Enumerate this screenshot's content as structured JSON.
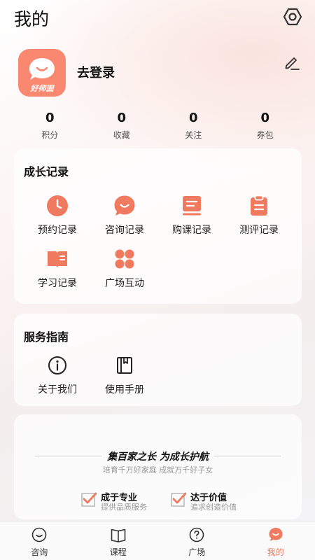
{
  "header": {
    "title": "我的"
  },
  "profile": {
    "login_text": "去登录",
    "avatar_brand": "好师固"
  },
  "stats": [
    {
      "value": "0",
      "label": "积分"
    },
    {
      "value": "0",
      "label": "收藏"
    },
    {
      "value": "0",
      "label": "关注"
    },
    {
      "value": "0",
      "label": "券包"
    }
  ],
  "growth": {
    "title": "成长记录",
    "items": [
      {
        "label": "预约记录",
        "icon": "clock-icon"
      },
      {
        "label": "咨询记录",
        "icon": "chat-bubble-icon"
      },
      {
        "label": "购课记录",
        "icon": "course-icon"
      },
      {
        "label": "测评记录",
        "icon": "clipboard-icon"
      },
      {
        "label": "学习记录",
        "icon": "open-book-icon"
      },
      {
        "label": "广场互动",
        "icon": "grid-dots-icon"
      }
    ]
  },
  "service": {
    "title": "服务指南",
    "items": [
      {
        "label": "关于我们",
        "icon": "info-icon"
      },
      {
        "label": "使用手册",
        "icon": "manual-icon"
      }
    ]
  },
  "promo": {
    "slogan": "集百家之长  为成长护航",
    "slogan_sub": "培育千万好家庭    成就万千好子女",
    "features": [
      {
        "title": "成于专业",
        "subtitle": "提供品质服务"
      },
      {
        "title": "达于价值",
        "subtitle": "追求创造价值"
      }
    ]
  },
  "tabs": [
    {
      "label": "咨询",
      "icon": "smile-icon"
    },
    {
      "label": "课程",
      "icon": "book-icon"
    },
    {
      "label": "广场",
      "icon": "question-icon"
    },
    {
      "label": "我的",
      "icon": "profile-mascot-icon",
      "active": true
    }
  ],
  "colors": {
    "accent": "#f07a5f",
    "avatar_bg": "#fa8870"
  }
}
